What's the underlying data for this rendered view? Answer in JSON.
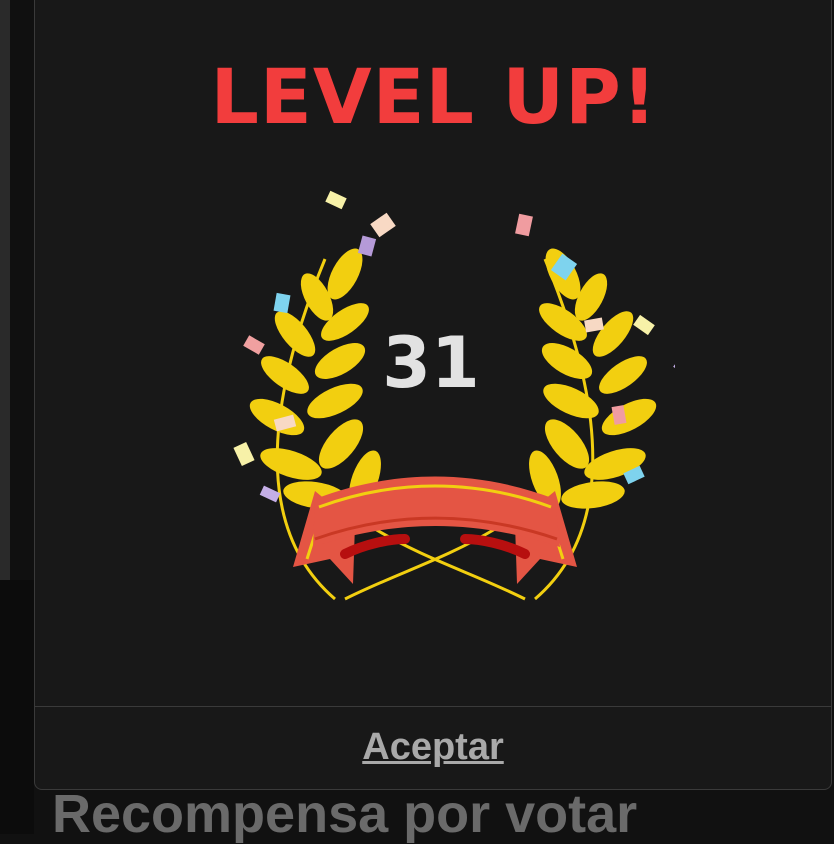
{
  "modal": {
    "title": "LEVEL UP!",
    "level": "31",
    "accept_label": "Aceptar",
    "title_color": "#f23d3d",
    "ribbon_color": "#e45544",
    "laurel_color": "#f2cf10"
  },
  "background": {
    "section_title": "Recompensa por votar"
  }
}
